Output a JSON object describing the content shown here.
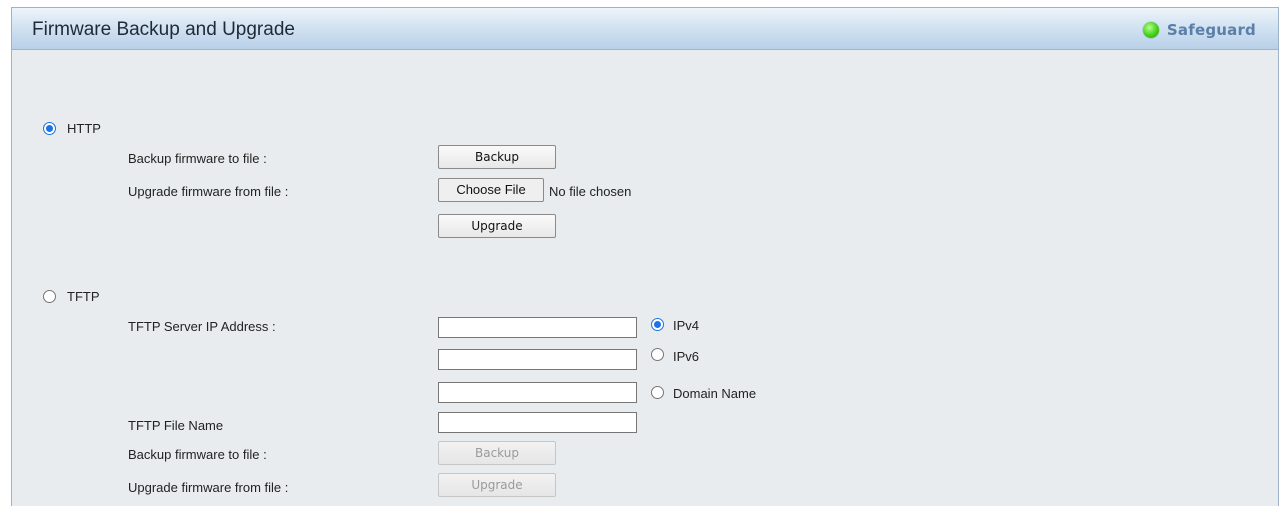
{
  "header": {
    "title": "Firmware Backup and Upgrade",
    "status_label": "Safeguard",
    "status_color": "#42d11c"
  },
  "http": {
    "label": "HTTP",
    "selected": true,
    "backup_label": "Backup firmware to file :",
    "backup_button": "Backup",
    "upgrade_label": "Upgrade firmware from file :",
    "choose_file_button": "Choose File",
    "no_file_text": "No file chosen",
    "upgrade_button": "Upgrade"
  },
  "tftp": {
    "label": "TFTP",
    "selected": false,
    "server_ip_label": "TFTP Server IP Address :",
    "ipv4_value": "",
    "ipv4_label": "IPv4",
    "ipv6_value": "",
    "ipv6_label": "IPv6",
    "domain_value": "",
    "domain_label": "Domain Name",
    "address_type_selected": "IPv4",
    "file_name_label": "TFTP File Name",
    "file_name_value": "",
    "backup_label": "Backup firmware to file :",
    "backup_button": "Backup",
    "upgrade_label": "Upgrade firmware from file :",
    "upgrade_button": "Upgrade"
  }
}
